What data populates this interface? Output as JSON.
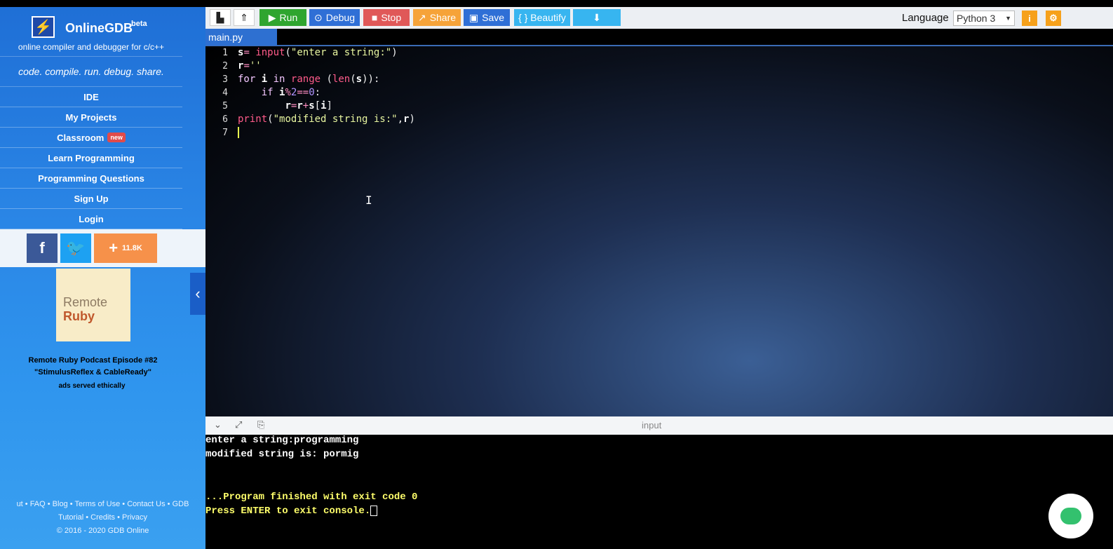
{
  "sidebar": {
    "brand_icon": "⚡",
    "brand_name": "OnlineGDB",
    "brand_beta": "beta",
    "brand_sub": "online compiler and debugger for c/c++",
    "tagline": "code. compile. run. debug. share.",
    "nav": [
      "IDE",
      "My Projects",
      "Classroom",
      "Learn Programming",
      "Programming Questions",
      "Sign Up",
      "Login"
    ],
    "classroom_badge": "new",
    "share_count": "11.8K",
    "ad_image_line1": "Remote",
    "ad_image_line2": "Ruby",
    "ad_line1": "Remote Ruby Podcast  Episode #82",
    "ad_line2": "\"StimulusReflex & CableReady\"",
    "ad_served": "ads served ethically",
    "footer_line1": "ut • FAQ • Blog • Terms of Use • Contact Us • GDB",
    "footer_line2": "Tutorial • Credits • Privacy",
    "footer_line3": "© 2016 - 2020 GDB Online"
  },
  "toolbar": {
    "run": "Run",
    "debug": "Debug",
    "stop": "Stop",
    "share": "Share",
    "save": "Save",
    "beautify": "{ } Beautify",
    "language_label": "Language",
    "language_value": "Python 3",
    "colors": {
      "run": "#2fa52f",
      "debug": "#2f6fd6",
      "stop": "#e05858",
      "share": "#f6a339",
      "save": "#2f6fd6",
      "beautify": "#37b5f0",
      "download": "#37b5f0"
    }
  },
  "editor": {
    "tab": "main.py",
    "line_numbers": [
      "1",
      "2",
      "3",
      "4",
      "5",
      "6",
      "7"
    ]
  },
  "console": {
    "title": "input",
    "line1": "enter a string:programming",
    "line2": "modified string is: pormig",
    "line3": "...Program finished with exit code 0",
    "line4": "Press ENTER to exit console."
  }
}
